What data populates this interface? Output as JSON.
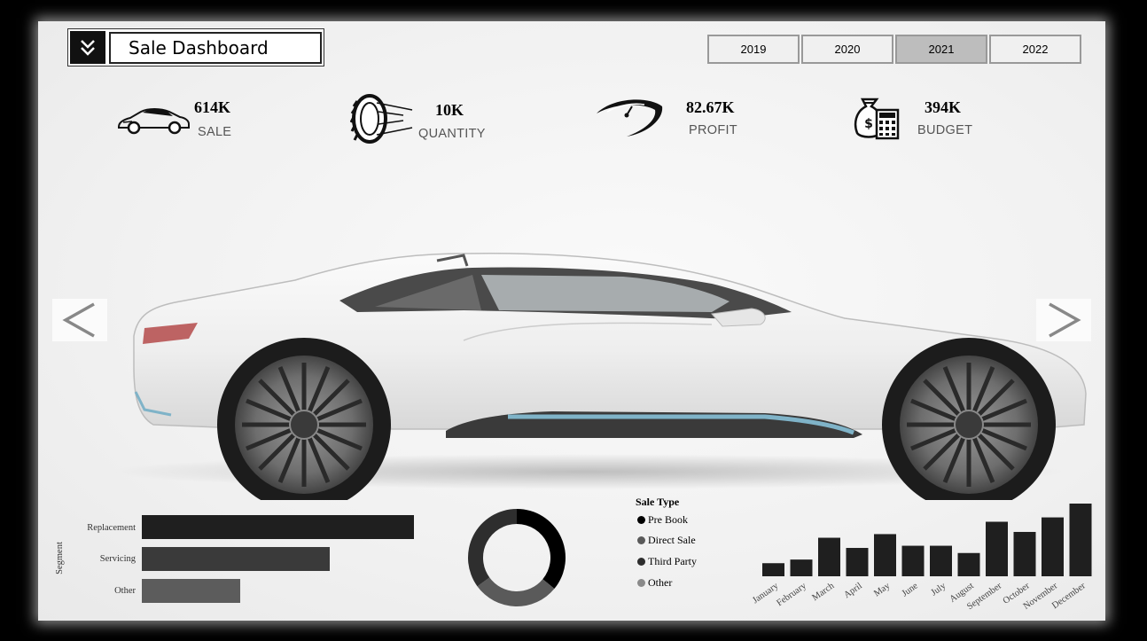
{
  "header": {
    "title": "Sale Dashboard",
    "menu_icon": "double-chevron-down-icon"
  },
  "years": {
    "tabs": [
      "2019",
      "2020",
      "2021",
      "2022"
    ],
    "selected": "2021"
  },
  "kpis": {
    "sale": {
      "value": "614K",
      "label": "SALE",
      "icon": "sports-car-icon"
    },
    "quantity": {
      "value": "10K",
      "label": "QUANTITY",
      "icon": "tire-icon"
    },
    "profit": {
      "value": "82.67K",
      "label": "PROFIT",
      "icon": "speedometer-swoosh-icon"
    },
    "budget": {
      "value": "394K",
      "label": "BUDGET",
      "icon": "money-bag-calculator-icon"
    }
  },
  "carousel": {
    "prev_icon": "chevron-left-icon",
    "next_icon": "chevron-right-icon"
  },
  "colors": {
    "bar_dark": "#1f1f1f",
    "bar_mid": "#3a3a3a",
    "bar_light": "#5c5c5c",
    "pre_book": "#000000",
    "direct_sale": "#5a5a5a",
    "third_party": "#2e2e2e",
    "other": "#8a8a8a"
  },
  "chart_data": [
    {
      "type": "bar",
      "orientation": "horizontal",
      "ylabel": "Segment",
      "categories": [
        "Replacement",
        "Servicing",
        "Other"
      ],
      "values": [
        100,
        69,
        36
      ]
    },
    {
      "type": "pie",
      "style": "donut",
      "legend_title": "Sale Type",
      "categories": [
        "Pre Book",
        "Direct Sale",
        "Third Party",
        "Other"
      ],
      "values": [
        36,
        29,
        35,
        0
      ]
    },
    {
      "type": "bar",
      "categories": [
        "January",
        "February",
        "March",
        "April",
        "May",
        "June",
        "July",
        "August",
        "September",
        "October",
        "November",
        "December"
      ],
      "values": [
        18,
        23,
        53,
        39,
        58,
        42,
        42,
        32,
        75,
        61,
        81,
        100
      ]
    }
  ]
}
